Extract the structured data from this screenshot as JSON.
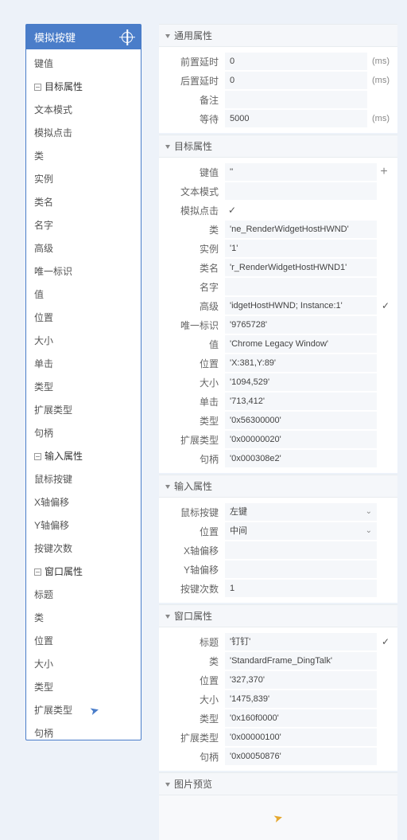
{
  "left": {
    "title": "模拟按键",
    "tree": [
      {
        "label": "键值",
        "type": "item"
      },
      {
        "label": "目标属性",
        "type": "group"
      },
      {
        "label": "文本模式",
        "type": "item"
      },
      {
        "label": "模拟点击",
        "type": "item"
      },
      {
        "label": "类",
        "type": "item"
      },
      {
        "label": "实例",
        "type": "item"
      },
      {
        "label": "类名",
        "type": "item"
      },
      {
        "label": "名字",
        "type": "item"
      },
      {
        "label": "高级",
        "type": "item"
      },
      {
        "label": "唯一标识",
        "type": "item"
      },
      {
        "label": "值",
        "type": "item"
      },
      {
        "label": "位置",
        "type": "item"
      },
      {
        "label": "大小",
        "type": "item"
      },
      {
        "label": "单击",
        "type": "item"
      },
      {
        "label": "类型",
        "type": "item"
      },
      {
        "label": "扩展类型",
        "type": "item"
      },
      {
        "label": "句柄",
        "type": "item"
      },
      {
        "label": "输入属性",
        "type": "group"
      },
      {
        "label": "鼠标按键",
        "type": "item"
      },
      {
        "label": "X轴偏移",
        "type": "item"
      },
      {
        "label": "Y轴偏移",
        "type": "item"
      },
      {
        "label": "按键次数",
        "type": "item"
      },
      {
        "label": "窗口属性",
        "type": "group"
      },
      {
        "label": "标题",
        "type": "item"
      },
      {
        "label": "类",
        "type": "item"
      },
      {
        "label": "位置",
        "type": "item"
      },
      {
        "label": "大小",
        "type": "item"
      },
      {
        "label": "类型",
        "type": "item"
      },
      {
        "label": "扩展类型",
        "type": "item"
      },
      {
        "label": "句柄",
        "type": "item"
      }
    ]
  },
  "sections": {
    "general": {
      "title": "通用属性",
      "pre_delay_label": "前置延时",
      "pre_delay": "0",
      "post_delay_label": "后置延时",
      "post_delay": "0",
      "remark_label": "备注",
      "remark": "",
      "wait_label": "等待",
      "wait": "5000",
      "ms": "(ms)"
    },
    "target": {
      "title": "目标属性",
      "key_label": "键值",
      "key": "''",
      "text_mode_label": "文本模式",
      "sim_click_label": "模拟点击",
      "sim_click": "✓",
      "class_label": "类",
      "class": "'ne_RenderWidgetHostHWND'",
      "instance_label": "实例",
      "instance": "'1'",
      "classname_label": "类名",
      "classname": "'r_RenderWidgetHostHWND1'",
      "name_label": "名字",
      "name": "",
      "advanced_label": "高级",
      "advanced": "'idgetHostHWND; Instance:1'",
      "uid_label": "唯一标识",
      "uid": "'9765728'",
      "value_label": "值",
      "value": "'Chrome Legacy Window'",
      "pos_label": "位置",
      "pos": "'X:381,Y:89'",
      "size_label": "大小",
      "size": "'1094,529'",
      "click_label": "单击",
      "click": "'713,412'",
      "type_label": "类型",
      "type": "'0x56300000'",
      "ext_label": "扩展类型",
      "ext": "'0x00000020'",
      "handle_label": "句柄",
      "handle": "'0x000308e2'"
    },
    "input": {
      "title": "输入属性",
      "mouse_label": "鼠标按键",
      "mouse": "左键",
      "pos_label": "位置",
      "pos": "中间",
      "xoff_label": "X轴偏移",
      "xoff": "",
      "yoff_label": "Y轴偏移",
      "yoff": "",
      "count_label": "按键次数",
      "count": "1"
    },
    "window": {
      "title": "窗口属性",
      "title_lbl": "标题",
      "title_val": "'钉钉'",
      "class_label": "类",
      "class": "'StandardFrame_DingTalk'",
      "pos_label": "位置",
      "pos": "'327,370'",
      "size_label": "大小",
      "size": "'1475,839'",
      "type_label": "类型",
      "type": "'0x160f0000'",
      "ext_label": "扩展类型",
      "ext": "'0x00000100'",
      "handle_label": "句柄",
      "handle": "'0x00050876'"
    },
    "preview": {
      "title": "图片预览"
    }
  }
}
